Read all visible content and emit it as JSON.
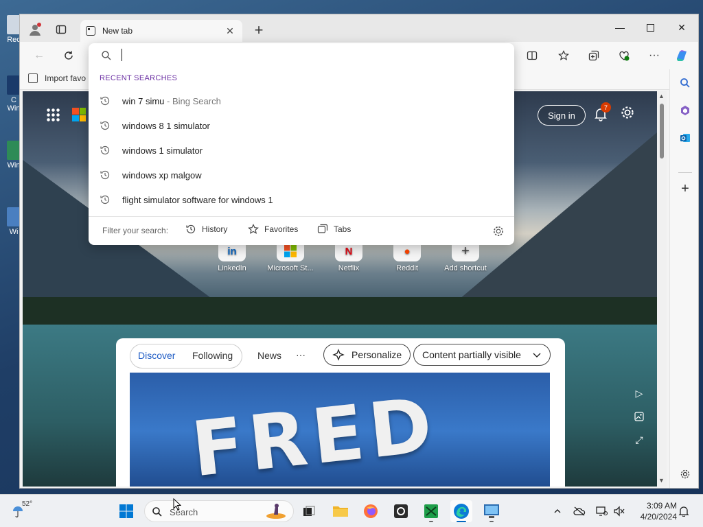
{
  "desktop": {
    "icons": [
      {
        "label": "Rec",
        "color": "#cfd8e3"
      },
      {
        "label": "C Win",
        "color": "#1a3a6a"
      },
      {
        "label": "Win",
        "color": "#2e8b57"
      },
      {
        "label": "Wi",
        "color": "#4a7fc0"
      }
    ]
  },
  "browser": {
    "tab": {
      "title": "New tab"
    },
    "new_tab_symbol": "+",
    "favorites_bar": {
      "import_label": "Import favo"
    }
  },
  "address_dropdown": {
    "recent_title": "RECENT SEARCHES",
    "items": [
      {
        "text": "win 7 simu",
        "suffix": " - Bing Search"
      },
      {
        "text": "windows 8 1 simulator",
        "suffix": ""
      },
      {
        "text": "windows 1 simulator",
        "suffix": ""
      },
      {
        "text": "windows xp malgow",
        "suffix": ""
      },
      {
        "text": "flight simulator software for windows 1",
        "suffix": ""
      }
    ],
    "filter": {
      "label": "Filter your search:",
      "history": "History",
      "favorites": "Favorites",
      "tabs": "Tabs"
    }
  },
  "newtab_page": {
    "sign_in": "Sign in",
    "notification_count": "7",
    "shortcuts": [
      {
        "label": "LinkedIn",
        "glyph": "in",
        "color": "#0a66c2"
      },
      {
        "label": "Microsoft St...",
        "glyph": "",
        "color": "#f25022"
      },
      {
        "label": "Netflix",
        "glyph": "N",
        "color": "#e50914"
      },
      {
        "label": "Reddit",
        "glyph": "●",
        "color": "#ff4500"
      },
      {
        "label": "Add shortcut",
        "glyph": "+",
        "color": "#444"
      }
    ],
    "feed": {
      "tabs": {
        "discover": "Discover",
        "following": "Following"
      },
      "news": "News",
      "more": "···",
      "personalize": "Personalize",
      "content_visibility": "Content partially visible",
      "hero_text": "FRED"
    }
  },
  "taskbar": {
    "weather_temp": "52°",
    "search_label": "Search",
    "time": "3:09 AM",
    "date": "4/20/2024"
  },
  "colors": {
    "accent": "#1f5cc5",
    "recent_title": "#6b2fa3",
    "badge": "#d83b01"
  }
}
